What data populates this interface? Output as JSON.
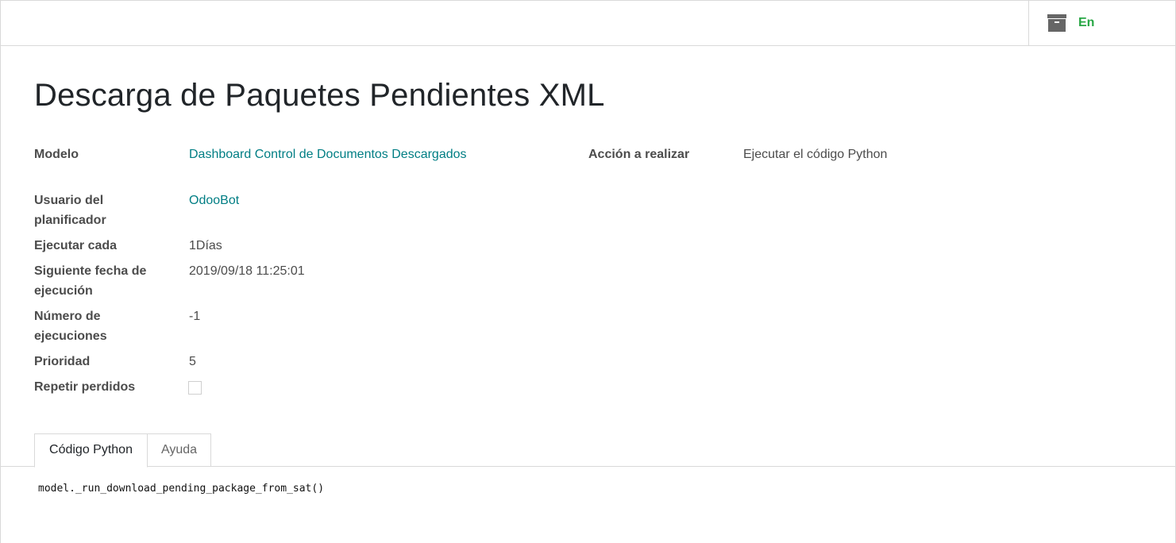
{
  "header": {
    "active_toggle": {
      "label": "En",
      "icon": "archive-icon"
    }
  },
  "form": {
    "title": "Descarga de Paquetes Pendientes XML",
    "model": {
      "label": "Modelo",
      "value": "Dashboard Control de Documentos Descargados"
    },
    "action": {
      "label": "Acción a realizar",
      "value": "Ejecutar el código Python"
    },
    "user": {
      "label_line1": "Usuario del",
      "label_line2": "planificador",
      "value": "OdooBot"
    },
    "interval": {
      "label": "Ejecutar cada",
      "value": "1Días"
    },
    "nextcall": {
      "label_line1": "Siguiente fecha de",
      "label_line2": "ejecución",
      "value": "2019/09/18 11:25:01"
    },
    "numbercall": {
      "label_line1": "Número de",
      "label_line2": "ejecuciones",
      "value": "-1"
    },
    "priority": {
      "label": "Prioridad",
      "value": "5"
    },
    "doall": {
      "label": "Repetir perdidos",
      "checked": false
    }
  },
  "tabs": [
    {
      "label": "Código Python",
      "active": true
    },
    {
      "label": "Ayuda",
      "active": false
    }
  ],
  "code": "model._run_download_pending_package_from_sat()",
  "colors": {
    "link": "#017e84",
    "active_green": "#28a745",
    "border": "#d9d9d9"
  }
}
